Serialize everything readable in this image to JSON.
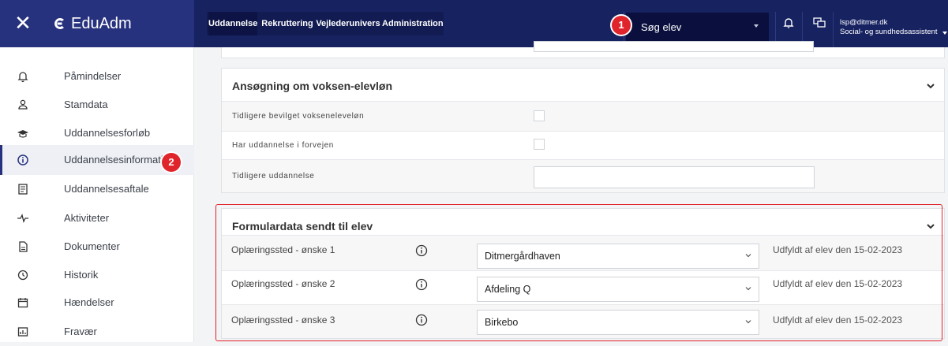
{
  "app": {
    "name": "EduAdm"
  },
  "nav": {
    "tabs": [
      "Uddannelse",
      "Rekruttering",
      "Vejlederunivers",
      "Administration"
    ]
  },
  "search": {
    "label": "Søg elev"
  },
  "user": {
    "email": "lsp@ditmer.dk",
    "role": "Social- og sundhedsassistent"
  },
  "badges": {
    "one": "1",
    "two": "2"
  },
  "sidebar": {
    "items": [
      {
        "label": "Påmindelser",
        "icon": "bell-icon"
      },
      {
        "label": "Stamdata",
        "icon": "person-icon"
      },
      {
        "label": "Uddannelsesforløb",
        "icon": "graduation-cap-icon"
      },
      {
        "label": "Uddannelsesinformation",
        "icon": "info-circle-icon"
      },
      {
        "label": "Uddannelsesaftale",
        "icon": "contract-icon"
      },
      {
        "label": "Aktiviteter",
        "icon": "pulse-icon"
      },
      {
        "label": "Dokumenter",
        "icon": "document-icon"
      },
      {
        "label": "Historik",
        "icon": "clock-icon"
      },
      {
        "label": "Hændelser",
        "icon": "calendar-icon"
      },
      {
        "label": "Fravær",
        "icon": "chart-icon"
      }
    ]
  },
  "voksen": {
    "title": "Ansøgning om voksen-elevløn",
    "rows": [
      {
        "label": "Tidligere bevilget vokseneleveløn"
      },
      {
        "label": "Har uddannelse i forvejen"
      },
      {
        "label": "Tidligere uddannelse"
      }
    ]
  },
  "formular": {
    "title": "Formulardata sendt til elev",
    "rows": [
      {
        "label": "Oplæringssted - ønske 1",
        "value": "Ditmergårdhaven",
        "note": "Udfyldt af elev den 15-02-2023"
      },
      {
        "label": "Oplæringssted - ønske 2",
        "value": "Afdeling Q",
        "note": "Udfyldt af elev den 15-02-2023"
      },
      {
        "label": "Oplæringssted - ønske 3",
        "value": "Birkebo",
        "note": "Udfyldt af elev den 15-02-2023"
      }
    ]
  }
}
